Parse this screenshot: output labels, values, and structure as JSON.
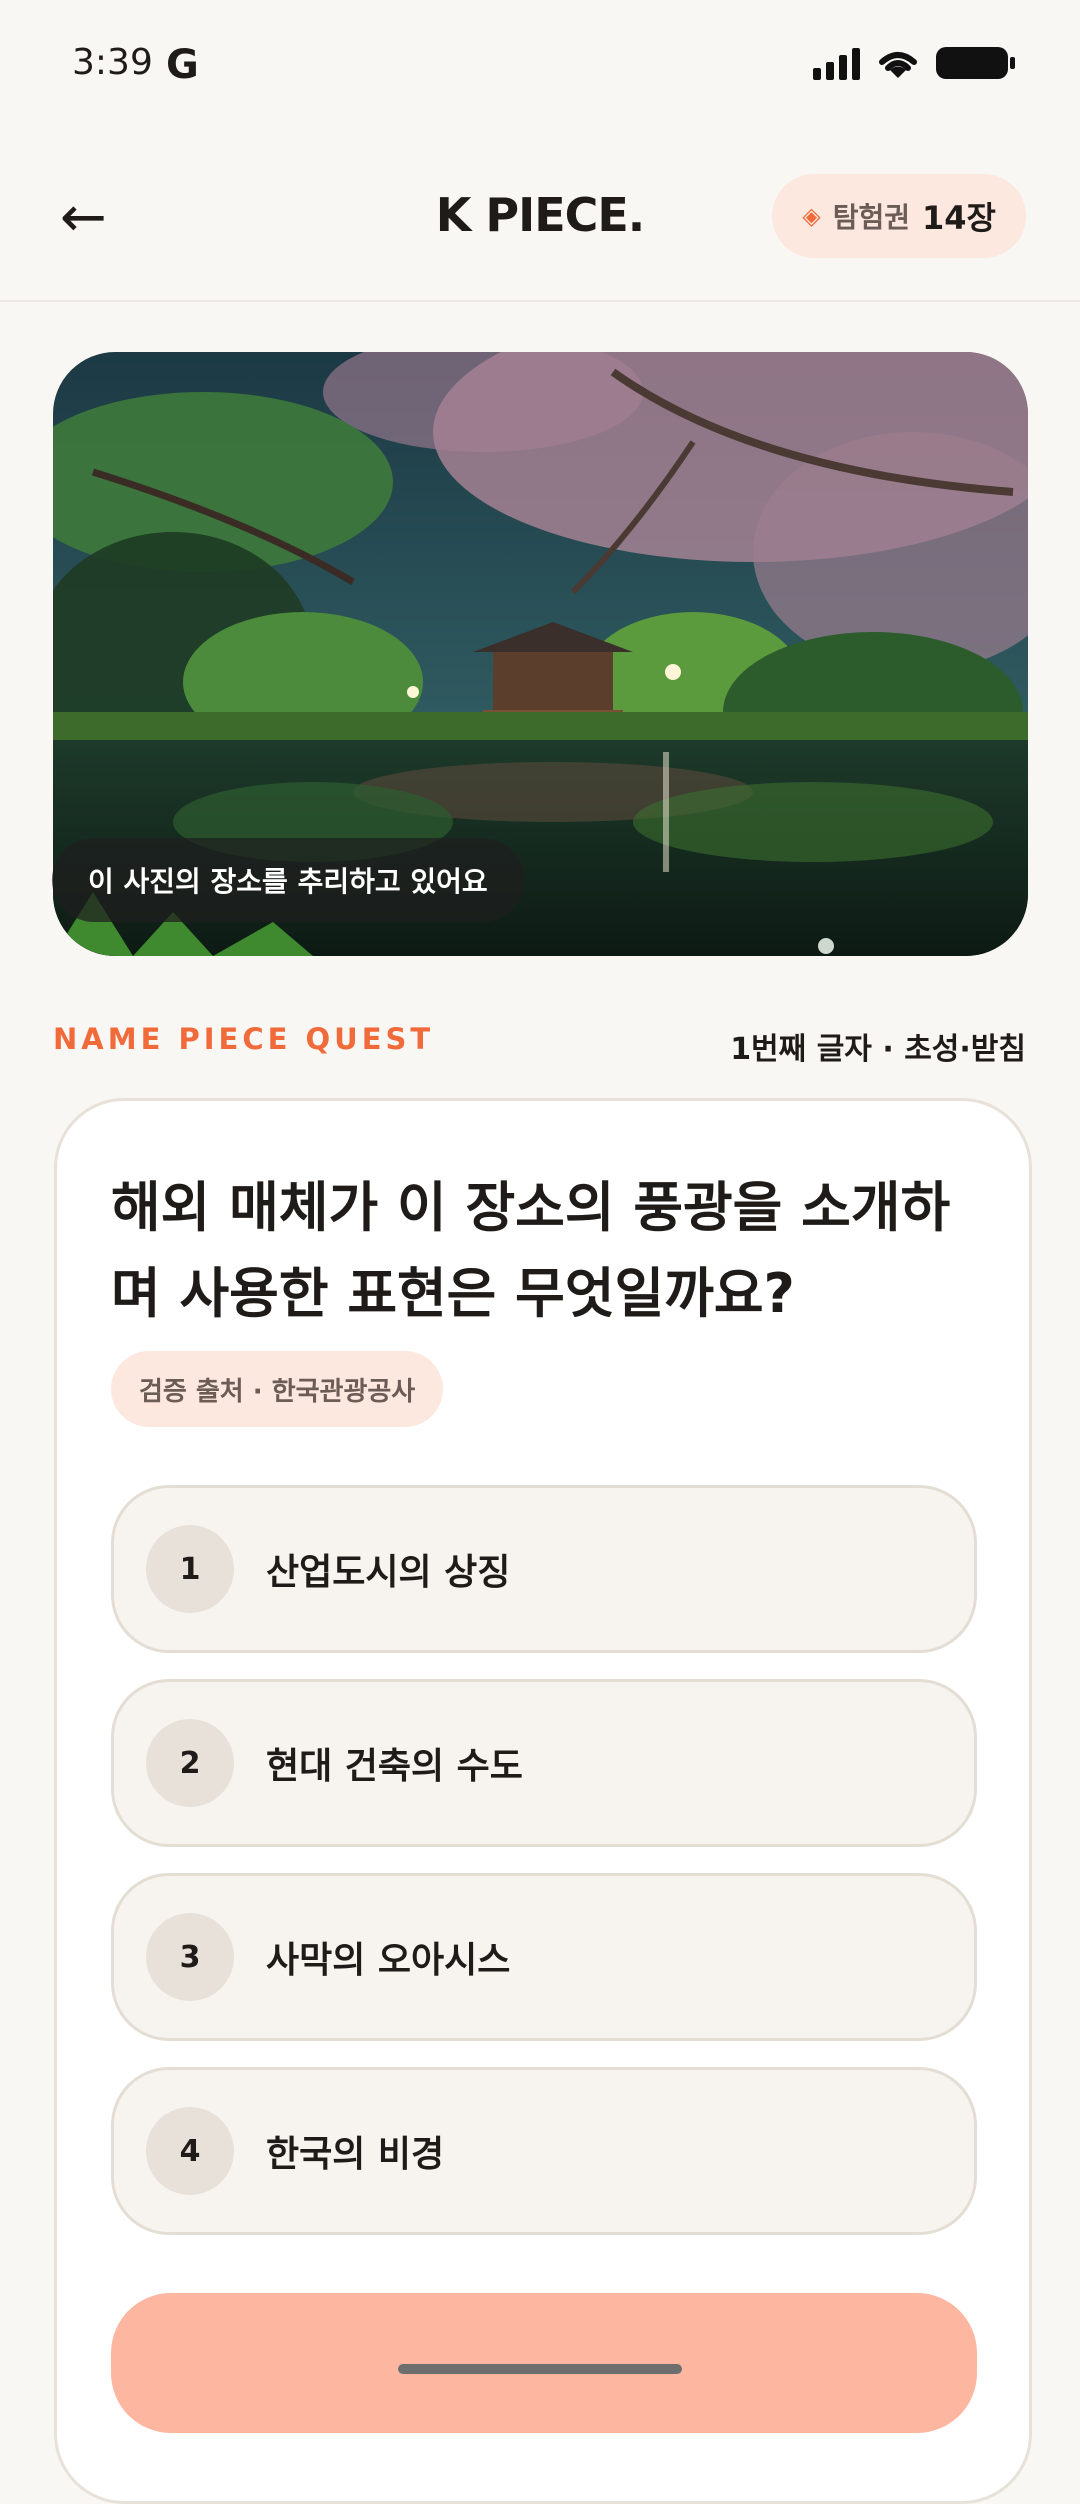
{
  "status_bar": {
    "time": "3:39",
    "app_icon": "G"
  },
  "header": {
    "back_icon": "←",
    "brand": "K PIECE.",
    "ticket_label": "탐험권",
    "ticket_count": "14장"
  },
  "hero": {
    "caption": "이 사진의 장소를 추리하고 있어요"
  },
  "quest": {
    "label": "NAME PIECE QUEST",
    "sub": "1번째 글자 · 초성·받침"
  },
  "card": {
    "question": "해외 매체가 이 장소의 풍광을 소개하며 사용한 표현은 무엇일까요?",
    "source": "검증 출처 · 한국관광공사",
    "options": [
      {
        "num": "1",
        "text": "산업도시의 상징"
      },
      {
        "num": "2",
        "text": "현대 건축의 수도"
      },
      {
        "num": "3",
        "text": "사막의 오아시스"
      },
      {
        "num": "4",
        "text": "한국의 비경"
      }
    ]
  },
  "colors": {
    "accent": "#f06a3a",
    "ticket_bg": "#fde8e0",
    "button": "#fdb7a0"
  }
}
